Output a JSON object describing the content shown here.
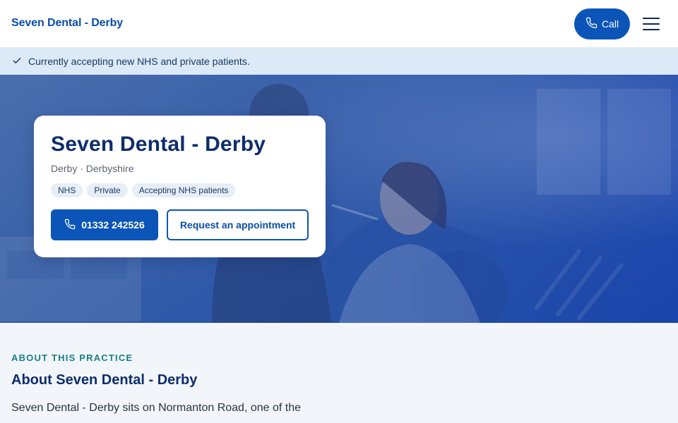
{
  "header": {
    "brand": "Seven Dental - Derby",
    "call_label": "Call",
    "call_icon": "phone-icon",
    "menu_icon": "hamburger-menu-icon"
  },
  "banner": {
    "icon": "checkmark-icon",
    "text": "Currently accepting new NHS and private patients."
  },
  "hero": {
    "title": "Seven Dental - Derby",
    "location": "Derby · Derbyshire",
    "tags": [
      "NHS",
      "Private",
      "Accepting NHS patients"
    ],
    "phone_label": "01332 242526",
    "appointment_label": "Request an appointment"
  },
  "about": {
    "eyebrow": "ABOUT THIS PRACTICE",
    "title": "About Seven Dental - Derby",
    "text": "Seven Dental - Derby sits on Normanton Road, one of the"
  },
  "colors": {
    "brand_blue": "#0b55b8",
    "heading_navy": "#0d2d6b",
    "banner_bg": "#dbeaf6",
    "eyebrow_teal": "#1a7f86"
  }
}
